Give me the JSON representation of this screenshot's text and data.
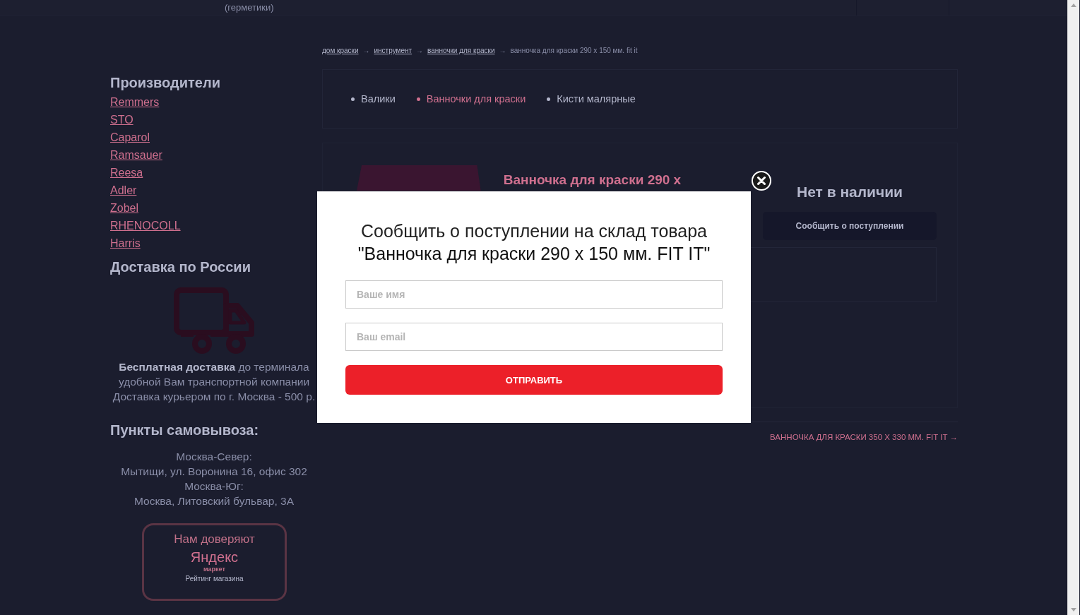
{
  "header": {
    "text": "(герметики)"
  },
  "sidebar": {
    "manufacturers": {
      "title": "Производители",
      "items": [
        "Remmers",
        "STO",
        "Caparol",
        "Ramsauer",
        "Reesa",
        "Adler",
        "Zobel",
        "RHENOCOLL",
        "Harris"
      ]
    },
    "delivery": {
      "title": "Доставка по России",
      "text": "**Бесплатная доставка** до терминала удобной Вам транспортной компании Доставка курьером по г. Москва - 500 р."
    },
    "pickup": {
      "title": "Пункты самовывоза:",
      "lines": [
        "Москва-Север:",
        "Мытищи, ул. Воронина 16, офис 302",
        "Москва-Юг:",
        "Москва, Литовский бульвар, 3А"
      ]
    },
    "trust_badge": {
      "title": "Нам доверяют",
      "logo": "Яндекс",
      "logo_sub": "маркет",
      "caption": "Рейтинг магазина"
    }
  },
  "breadcrumbs": [
    {
      "label": "дом краски",
      "arrow": "→"
    },
    {
      "label": "инструмент",
      "arrow": "→"
    },
    {
      "label": "ванночки для краски",
      "arrow": "→"
    },
    {
      "label": "ванночка для краски 290 x 150 мм. fit it"
    }
  ],
  "categories": [
    {
      "label": "Валики",
      "selected": false
    },
    {
      "label": "Ванночки для краски",
      "selected": true
    },
    {
      "label": "Кисти малярные",
      "selected": false
    }
  ],
  "product": {
    "title": "Ванночка для краски 290 x",
    "availability": "Нет в наличии",
    "notify_button": "Сообщить о поступлении"
  },
  "next_product": "ВАННОЧКА ДЛЯ КРАСКИ 350 X 330 ММ. FIT IT →",
  "modal": {
    "title": "Сообщить о поступлении на склад товара",
    "product_name": "\"Ванночка для краски 290 x 150 мм. FIT IT\"",
    "fields": [
      {
        "placeholder": "Ваше имя"
      },
      {
        "placeholder": "Ваш email"
      }
    ],
    "submit": "ОТПРАВИТЬ"
  }
}
